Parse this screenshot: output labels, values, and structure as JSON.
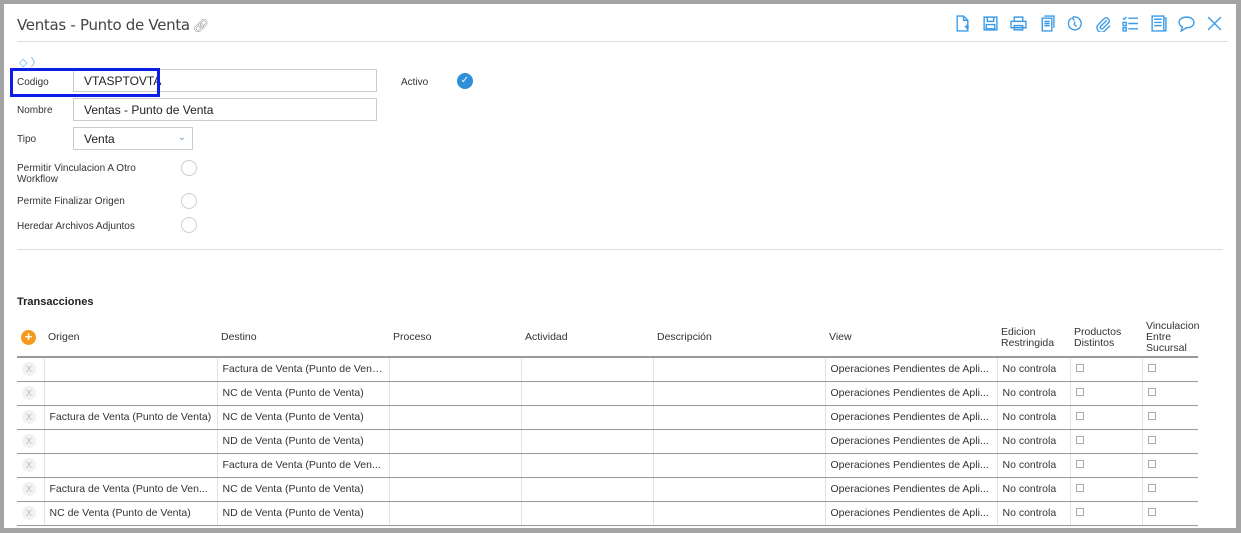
{
  "header": {
    "title": "Ventas - Punto de Venta"
  },
  "toolbar": [
    "new-document",
    "save",
    "print",
    "copy",
    "history",
    "attach",
    "checklist",
    "report",
    "comment",
    "close"
  ],
  "form": {
    "codigo_label": "Codigo",
    "codigo_value": "VTASPTOVTA",
    "nombre_label": "Nombre",
    "nombre_value": "Ventas - Punto de Venta",
    "tipo_label": "Tipo",
    "tipo_value": "Venta",
    "activo_label": "Activo",
    "activo_checked": true,
    "permitir_vinculacion_label": "Permitir Vinculacion A Otro Workflow",
    "permite_finalizar_label": "Permite Finalizar Origen",
    "heredar_archivos_label": "Heredar Archivos Adjuntos"
  },
  "transacciones": {
    "title": "Transacciones",
    "columns": [
      "Origen",
      "Destino",
      "Proceso",
      "Actividad",
      "Descripción",
      "View",
      "Edicion Restringida",
      "Productos Distintos",
      "Vinculacion Entre Sucursal"
    ],
    "rows": [
      {
        "origen": "",
        "destino": "Factura de Venta (Punto de Venta)",
        "proceso": "",
        "actividad": "",
        "descripcion": "",
        "view": "Operaciones Pendientes de Apli...",
        "edicion": "No controla"
      },
      {
        "origen": "",
        "destino": "NC de Venta (Punto de Venta)",
        "proceso": "",
        "actividad": "",
        "descripcion": "",
        "view": "Operaciones Pendientes de Apli...",
        "edicion": "No controla"
      },
      {
        "origen": "Factura de Venta (Punto de Venta)",
        "destino": "NC de Venta (Punto de Venta)",
        "proceso": "",
        "actividad": "",
        "descripcion": "",
        "view": "Operaciones Pendientes de Apli...",
        "edicion": "No controla"
      },
      {
        "origen": "",
        "destino": "ND de Venta (Punto de Venta)",
        "proceso": "",
        "actividad": "",
        "descripcion": "",
        "view": "Operaciones Pendientes de Apli...",
        "edicion": "No controla"
      },
      {
        "origen": "",
        "destino": "Factura de Venta (Punto de Ven...",
        "proceso": "",
        "actividad": "",
        "descripcion": "",
        "view": "Operaciones Pendientes de Apli...",
        "edicion": "No controla"
      },
      {
        "origen": "Factura de Venta (Punto de Ven...",
        "destino": "NC de Venta (Punto de Venta)",
        "proceso": "",
        "actividad": "",
        "descripcion": "",
        "view": "Operaciones Pendientes de Apli...",
        "edicion": "No controla"
      },
      {
        "origen": "NC de Venta (Punto de Venta)",
        "destino": "ND de Venta (Punto de Venta)",
        "proceso": "",
        "actividad": "",
        "descripcion": "",
        "view": "Operaciones Pendientes de Apli...",
        "edicion": "No controla"
      }
    ]
  }
}
